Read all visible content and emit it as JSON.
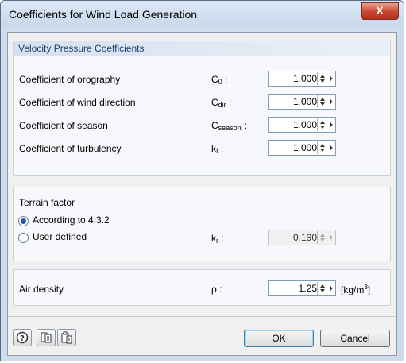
{
  "window": {
    "title": "Coefficients for Wind Load Generation",
    "close_label": "X"
  },
  "velocity": {
    "header": "Velocity Pressure Coefficients",
    "rows": [
      {
        "label": "Coefficient of orography",
        "sym": "C",
        "sub": "0",
        "suffix": " :",
        "value": "1.000"
      },
      {
        "label": "Coefficient of wind direction",
        "sym": "C",
        "sub": "dir",
        "suffix": " :",
        "value": "1.000"
      },
      {
        "label": "Coefficient of season",
        "sym": "C",
        "sub": "season",
        "suffix": " :",
        "value": "1.000"
      },
      {
        "label": "Coefficient of turbulency",
        "sym": "k",
        "sub": "I",
        "suffix": " :",
        "value": "1.000"
      }
    ]
  },
  "terrain": {
    "label": "Terrain factor",
    "option1": "According to 4.3.2",
    "option2": "User defined",
    "selected": "According to 4.3.2",
    "sym": "k",
    "sub": "r",
    "suffix": " :",
    "value": "0.190"
  },
  "air": {
    "label": "Air density",
    "sym": "ρ :",
    "value": "1.25",
    "unit": "[kg/m",
    "unit_sup": "3",
    "unit_close": "]"
  },
  "buttons": {
    "ok": "OK",
    "cancel": "Cancel"
  },
  "icons": [
    "help-icon",
    "copy-icon",
    "paste-icon"
  ]
}
